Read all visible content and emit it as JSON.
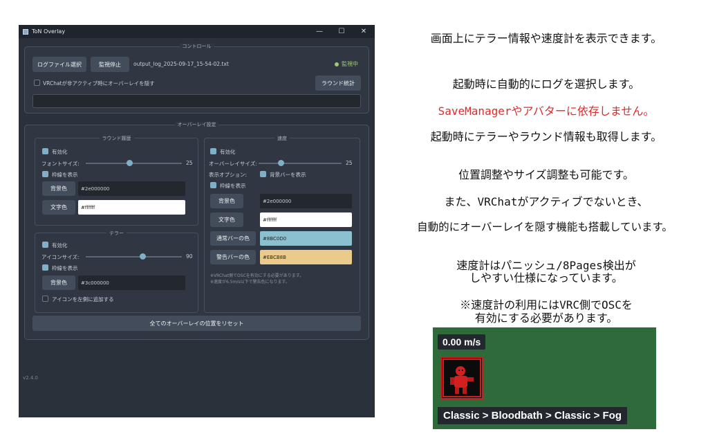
{
  "window": {
    "title": "ToN Overlay",
    "minimize": "—",
    "maximize": "☐",
    "close": "✕",
    "version": "v2.4.0"
  },
  "control": {
    "title": "コントロール",
    "select_log": "ログファイル選択",
    "stop_monitor": "監視停止",
    "log_file": "output_log_2025-09-17_15-54-02.txt",
    "status": "監視中",
    "hide_when_inactive": "VRChatが非アクティブ時にオーバーレイを隠す",
    "round_stats": "ラウンド統計"
  },
  "overlay": {
    "title": "オーバーレイ設定",
    "round_history": {
      "title": "ラウンド履歴",
      "enable": "有効化",
      "font_size_label": "フォントサイズ:",
      "font_size_value": "25",
      "font_size_fraction": 0.45,
      "show_border": "枠線を表示",
      "bg_label": "背景色",
      "bg_value": "#2e000000",
      "text_label": "文字色",
      "text_value": "#ffffff"
    },
    "terror": {
      "title": "テラー",
      "enable": "有効化",
      "icon_size_label": "アイコンサイズ:",
      "icon_size_value": "90",
      "icon_size_fraction": 0.6,
      "show_border": "枠線を表示",
      "bg_label": "背景色",
      "bg_value": "#3c000000",
      "add_icon_left": "アイコンを左側に追加する"
    },
    "speed": {
      "title": "速度",
      "enable": "有効化",
      "overlay_size_label": "オーバーレイサイズ:",
      "overlay_size_value": "25",
      "overlay_size_fraction": 0.25,
      "display_option_label": "表示オプション:",
      "bg_bar": "背景バーを表示",
      "show_border": "枠線を表示",
      "bg_label": "背景色",
      "bg_value": "#2e000000",
      "text_label": "文字色",
      "text_value": "#ffffff",
      "normal_bar_label": "通常バーの色",
      "normal_bar_value": "#8BC0D0",
      "warn_bar_label": "警告バーの色",
      "warn_bar_value": "#EBCB8B",
      "note1": "※VRChat側でOSCを有効にする必要があります。",
      "note2": "※速度が6.5m/s以下で警告色になります。"
    },
    "reset_positions": "全てのオーバーレイの位置をリセット"
  },
  "description": {
    "line1": "画面上にテラー情報や速度計を表示できます。",
    "line2": "起動時に自動的にログを選択します。",
    "line3": "SaveManagerやアバターに依存しません。",
    "line4": "起動時にテラーやラウンド情報も取得します。",
    "line5": "位置調整やサイズ調整も可能です。",
    "line6": "また、VRChatがアクティブでないとき、",
    "line7": "自動的にオーバーレイを隠す機能も搭載しています。",
    "line8": "速度計はパニッシュ/8Pages検出が",
    "line9": "しやすい仕様になっています。",
    "line10": "※速度計の利用にはVRC側でOSCを",
    "line11": "有効にする必要があります。"
  },
  "speed_widget": {
    "speed": "0.00 m/s",
    "route": "Classic > Bloodbath > Classic > Fog"
  },
  "colors": {
    "normal_bar": "#8BC0D0",
    "warn_bar": "#EBCB8B",
    "accent_red": "#E02A2A",
    "widget_bg": "#2F6B3A"
  }
}
